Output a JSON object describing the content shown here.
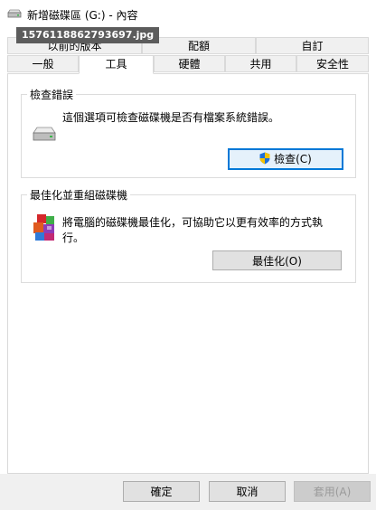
{
  "window": {
    "title": "新增磁碟區 (G:) - 內容",
    "filename_overlay": "1576118862793697.jpg"
  },
  "tabs": {
    "row1": [
      {
        "label": "以前的版本"
      },
      {
        "label": "配額"
      },
      {
        "label": "自訂"
      }
    ],
    "row2": [
      {
        "label": "一般"
      },
      {
        "label": "工具",
        "active": true
      },
      {
        "label": "硬體"
      },
      {
        "label": "共用"
      },
      {
        "label": "安全性"
      }
    ]
  },
  "error_check": {
    "group_title": "檢查錯誤",
    "description": "這個選項可檢查磁碟機是否有檔案系統錯誤。",
    "button_label": "檢查(C)",
    "icon": "drive-icon",
    "button_icon": "uac-shield-icon"
  },
  "optimize": {
    "group_title": "最佳化並重組磁碟機",
    "description": "將電腦的磁碟機最佳化，可協助它以更有效率的方式執行。",
    "button_label": "最佳化(O)",
    "icon": "defrag-icon"
  },
  "dialog_buttons": {
    "ok": "確定",
    "cancel": "取消",
    "apply": "套用(A)"
  },
  "colors": {
    "focus_border": "#0078d7",
    "button_face": "#e1e1e1",
    "window_bg": "#f0f0f0"
  }
}
